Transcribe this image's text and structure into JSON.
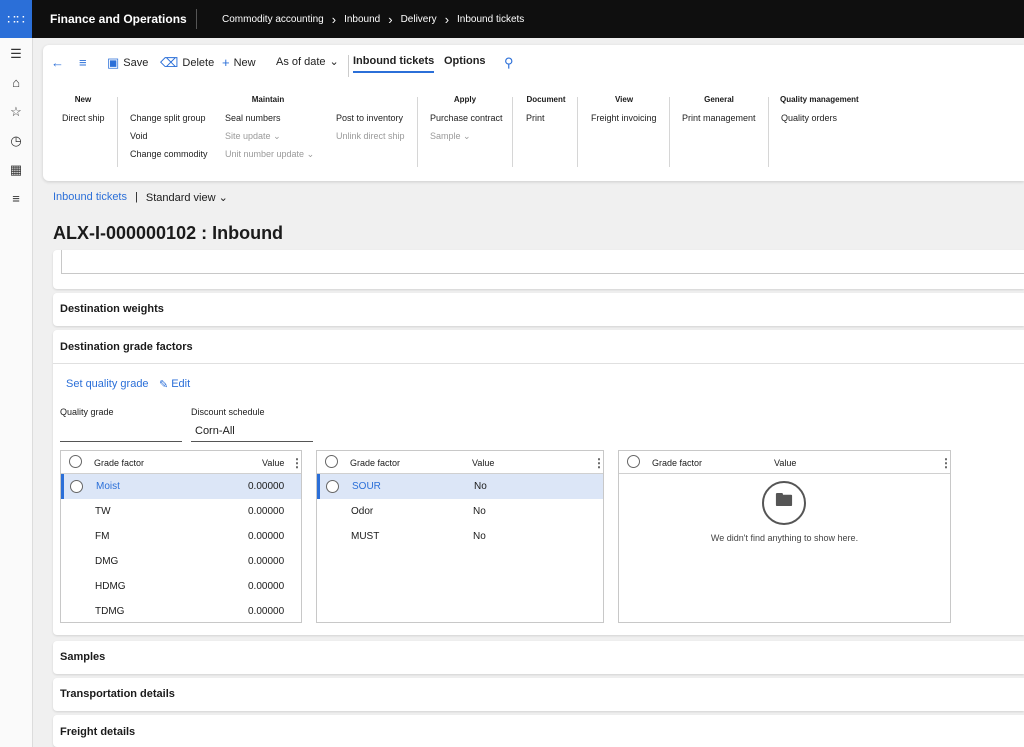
{
  "app": {
    "name": "Finance and Operations"
  },
  "breadcrumbs": [
    "Commodity accounting",
    "Inbound",
    "Delivery",
    "Inbound tickets"
  ],
  "nav_icons": [
    "menu-icon",
    "home-icon",
    "star-icon",
    "clock-icon",
    "workspace-icon",
    "list-icon"
  ],
  "toolbar": {
    "save": "Save",
    "delete": "Delete",
    "new": "New",
    "as_of_date": "As of date",
    "tab_inbound": "Inbound tickets",
    "tab_options": "Options"
  },
  "ribbon": {
    "new": {
      "header": "New",
      "items": [
        "Direct ship"
      ]
    },
    "maintain": {
      "header": "Maintain",
      "col1": [
        "Change split group",
        "Void",
        "Change commodity"
      ],
      "col2": [
        "Seal numbers",
        "Site update",
        "Unit number update"
      ],
      "col3": [
        "Post to inventory",
        "Unlink direct ship"
      ]
    },
    "apply": {
      "header": "Apply",
      "items": [
        "Purchase contract",
        "Sample"
      ]
    },
    "document": {
      "header": "Document",
      "items": [
        "Print"
      ]
    },
    "view": {
      "header": "View",
      "items": [
        "Freight invoicing"
      ]
    },
    "general": {
      "header": "General",
      "items": [
        "Print management"
      ]
    },
    "quality": {
      "header": "Quality management",
      "items": [
        "Quality orders"
      ]
    }
  },
  "view": {
    "link": "Inbound tickets",
    "sep": "|",
    "standard": "Standard view"
  },
  "page_title": "ALX-I-000000102 : Inbound",
  "sections": {
    "dest_weights": "Destination weights",
    "dest_grade": "Destination grade factors",
    "samples": "Samples",
    "transport": "Transportation details",
    "freight": "Freight details"
  },
  "actions": {
    "set_quality": "Set quality grade",
    "edit": "Edit"
  },
  "fields": {
    "quality_grade_label": "Quality grade",
    "quality_grade_value": "",
    "discount_label": "Discount schedule",
    "discount_value": "Corn-All"
  },
  "grid_headers": {
    "factor": "Grade factor",
    "value": "Value"
  },
  "grid1": [
    {
      "factor": "Moist",
      "value": "0.00000"
    },
    {
      "factor": "TW",
      "value": "0.00000"
    },
    {
      "factor": "FM",
      "value": "0.00000"
    },
    {
      "factor": "DMG",
      "value": "0.00000"
    },
    {
      "factor": "HDMG",
      "value": "0.00000"
    },
    {
      "factor": "TDMG",
      "value": "0.00000"
    }
  ],
  "grid2": [
    {
      "factor": "SOUR",
      "value": "No"
    },
    {
      "factor": "Odor",
      "value": "No"
    },
    {
      "factor": "MUST",
      "value": "No"
    }
  ],
  "grid3_empty": "We didn't find anything to show here.",
  "colors": {
    "accent": "#2b6fd8",
    "topbar": "#0f0f0f",
    "selected_row": "#dce6f7"
  }
}
